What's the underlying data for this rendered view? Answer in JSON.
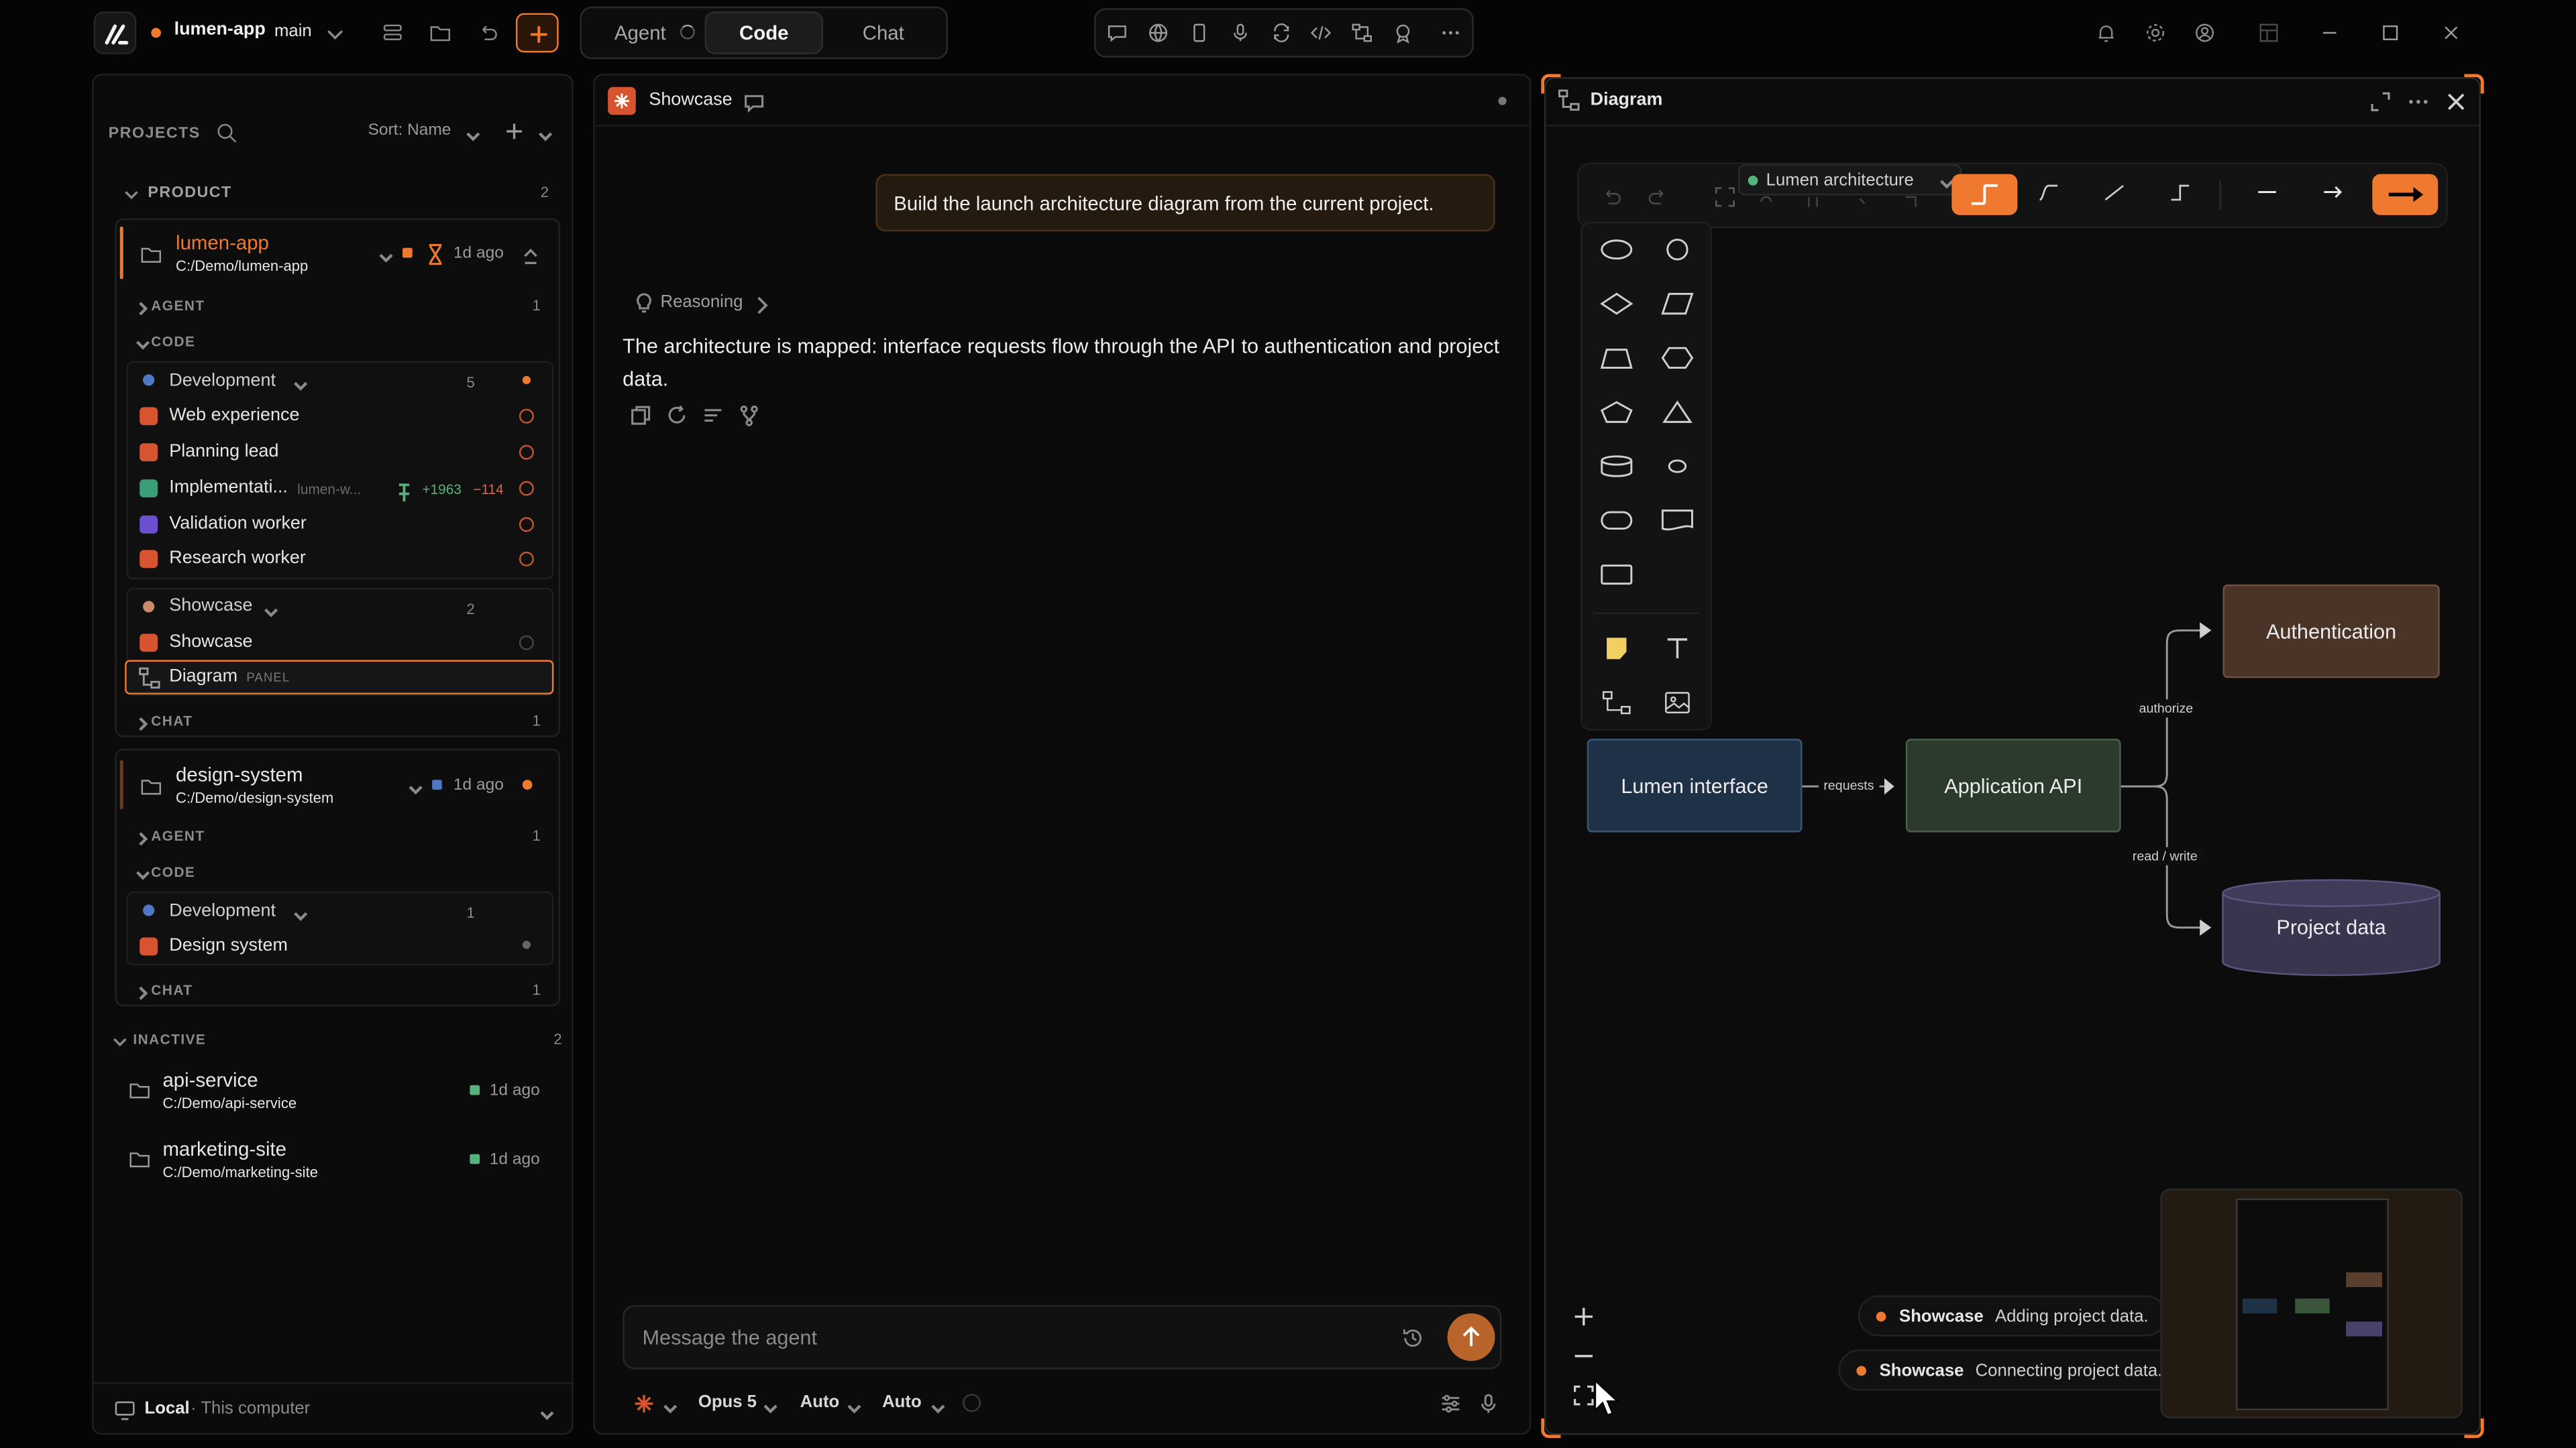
{
  "project": {
    "name": "lumen-app",
    "branch": "main"
  },
  "top_tabs": {
    "agent": "Agent",
    "code": "Code",
    "chat": "Chat"
  },
  "sidebar": {
    "title": "PROJECTS",
    "sort": "Sort: Name",
    "group": {
      "label": "PRODUCT",
      "count": "2"
    },
    "lumen": {
      "name": "lumen-app",
      "path": "C:/Demo/lumen-app",
      "age": "1d ago"
    },
    "sections": {
      "agent": "AGENT",
      "code": "CODE",
      "chat": "CHAT",
      "agent_count": "1",
      "chat_count": "1"
    },
    "dev": {
      "label": "Development",
      "count": "5"
    },
    "items": [
      {
        "label": "Web experience"
      },
      {
        "label": "Planning lead"
      },
      {
        "label": "Implementati...",
        "sub": "lumen-w...",
        "added": "+1963",
        "removed": "−114"
      },
      {
        "label": "Validation worker"
      },
      {
        "label": "Research worker"
      }
    ],
    "showcase": {
      "label": "Showcase",
      "count": "2",
      "item": "Showcase",
      "diagram": "Diagram",
      "panel_tag": "PANEL"
    },
    "design": {
      "name": "design-system",
      "path": "C:/Demo/design-system",
      "age": "1d ago",
      "dev": "Development",
      "dev_count": "1",
      "item": "Design system"
    },
    "inactive": {
      "label": "INACTIVE",
      "count": "2"
    },
    "inactive_items": [
      {
        "name": "api-service",
        "path": "C:/Demo/api-service",
        "age": "1d ago"
      },
      {
        "name": "marketing-site",
        "path": "C:/Demo/marketing-site",
        "age": "1d ago"
      }
    ],
    "footer": {
      "label": "Local",
      "sub": "· This computer"
    }
  },
  "chat": {
    "header": "Showcase",
    "user_message": "Build the launch architecture diagram from the current project.",
    "reasoning": "Reasoning",
    "answer": "The architecture is mapped: interface requests flow through the API to authentication and project data.",
    "input_placeholder": "Message the agent",
    "model": "Opus 5",
    "auto1": "Auto",
    "auto2": "Auto"
  },
  "diagram": {
    "header": "Diagram",
    "doc_name": "Lumen architecture",
    "nodes": {
      "interface": "Lumen interface",
      "api": "Application API",
      "auth": "Authentication",
      "data": "Project data"
    },
    "edges": {
      "requests": "requests",
      "authorize": "authorize",
      "readwrite": "read / write"
    },
    "toasts": [
      {
        "tag": "Showcase",
        "text": "Adding project data."
      },
      {
        "tag": "Showcase",
        "text": "Connecting project data."
      }
    ]
  },
  "colors": {
    "accent": "#ef7a2f",
    "bg": "#050505",
    "panel": "#0b0b0b",
    "interface_node": "#1f3147",
    "api_node": "#2b3a2c",
    "auth_node": "#4a3428",
    "data_node": "#3a344f"
  }
}
